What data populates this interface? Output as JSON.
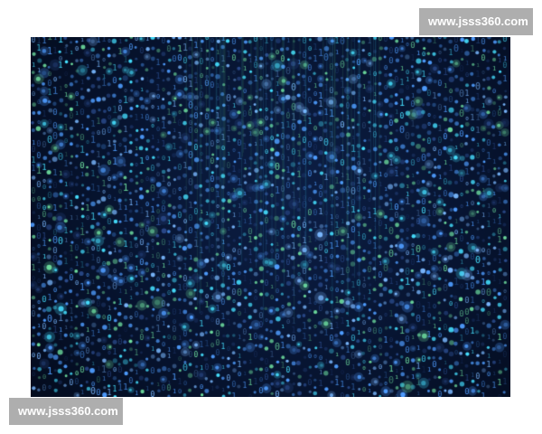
{
  "photo": {
    "subject": "blue binary digital rain",
    "colors": {
      "background": "#030a1a",
      "glow_center": "#0c1e44",
      "digit_primary": "#4f9dff",
      "digit_cyan": "#46e0ff",
      "digit_green": "#6fe0a0",
      "digit_dim": "#2a4a8a"
    }
  },
  "watermarks": {
    "top_text": "www.jsss360.com",
    "bottom_text": "www.jsss360.com",
    "background": "#a0a0a0",
    "text_color": "#ffffff"
  }
}
